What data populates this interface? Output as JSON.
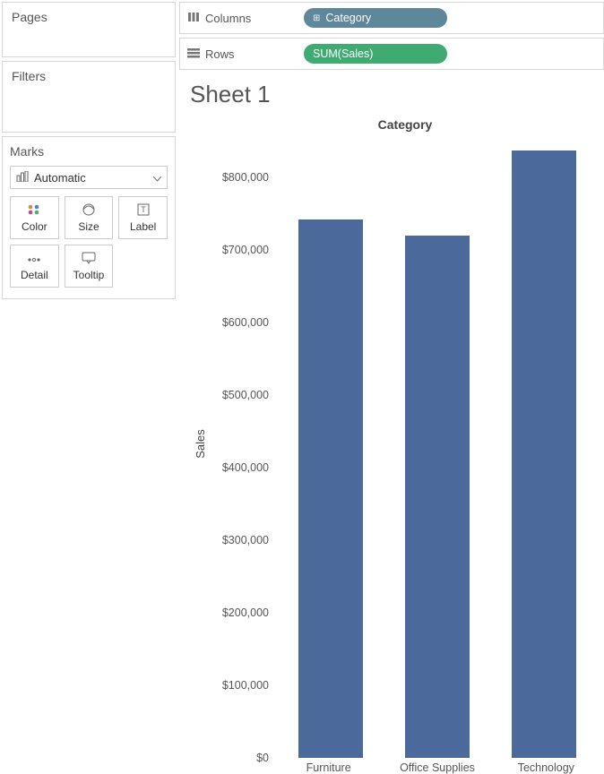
{
  "left": {
    "pages_title": "Pages",
    "filters_title": "Filters",
    "marks_title": "Marks",
    "marks_select_label": "Automatic",
    "marks_buttons": {
      "color": "Color",
      "size": "Size",
      "label": "Label",
      "detail": "Detail",
      "tooltip": "Tooltip"
    }
  },
  "shelves": {
    "columns_label": "Columns",
    "rows_label": "Rows",
    "columns_pill": "Category",
    "rows_pill": "SUM(Sales)"
  },
  "sheet": {
    "title": "Sheet 1",
    "column_header": "Category",
    "y_axis_label": "Sales"
  },
  "chart_data": {
    "type": "bar",
    "categories": [
      "Furniture",
      "Office Supplies",
      "Technology"
    ],
    "values": [
      742000,
      719000,
      836000
    ],
    "ylabel": "Sales",
    "ylim": [
      0,
      850000
    ],
    "yticks": [
      0,
      100000,
      200000,
      300000,
      400000,
      500000,
      600000,
      700000,
      800000
    ],
    "ytick_labels": [
      "$0",
      "$100,000",
      "$200,000",
      "$300,000",
      "$400,000",
      "$500,000",
      "$600,000",
      "$700,000",
      "$800,000"
    ],
    "title": "Category"
  }
}
